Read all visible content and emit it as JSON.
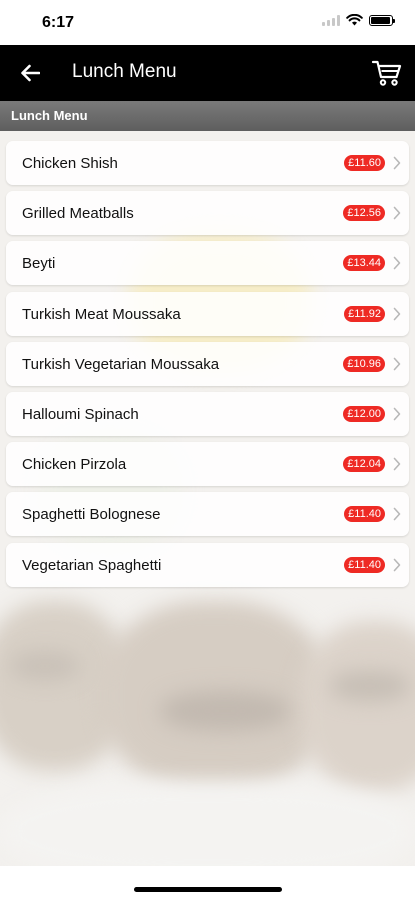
{
  "status_bar": {
    "time": "6:17"
  },
  "nav": {
    "title": "Lunch Menu"
  },
  "section": {
    "header": "Lunch Menu"
  },
  "menu": {
    "items": [
      {
        "name": "Chicken Shish",
        "price": "£11.60"
      },
      {
        "name": "Grilled Meatballs",
        "price": "£12.56"
      },
      {
        "name": "Beyti",
        "price": "£13.44"
      },
      {
        "name": "Turkish Meat Moussaka",
        "price": "£11.92"
      },
      {
        "name": "Turkish Vegetarian Moussaka",
        "price": "£10.96"
      },
      {
        "name": "Halloumi Spinach",
        "price": "£12.00"
      },
      {
        "name": "Chicken Pirzola",
        "price": "£12.04"
      },
      {
        "name": "Spaghetti Bolognese",
        "price": "£11.40"
      },
      {
        "name": "Vegetarian Spaghetti",
        "price": "£11.40"
      }
    ]
  },
  "colors": {
    "nav_background": "#000000",
    "section_header": "#6a6a6a",
    "price_badge": "#ee2a24"
  },
  "icons": {
    "back": "arrow-left-icon",
    "cart": "cart-icon",
    "row_chevron": "chevron-right-icon"
  }
}
